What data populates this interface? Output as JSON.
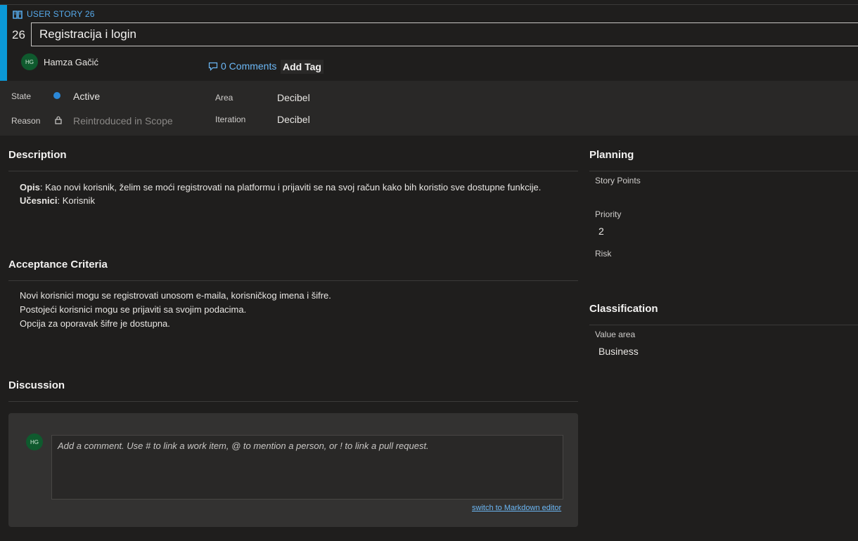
{
  "work_item": {
    "type_label": "USER STORY 26",
    "id": "26",
    "title": "Registracija i login",
    "assignee": {
      "initials": "HG",
      "name": "Hamza Gačić"
    },
    "comments_label": "0 Comments",
    "add_tag_label": "Add Tag"
  },
  "fields": {
    "state": {
      "label": "State",
      "value": "Active",
      "status_color": "#2b88d8"
    },
    "reason": {
      "label": "Reason",
      "value": "Reintroduced in Scope"
    },
    "area": {
      "label": "Area",
      "value": "Decibel"
    },
    "iteration": {
      "label": "Iteration",
      "value": "Decibel"
    }
  },
  "description": {
    "title": "Description",
    "opis_label": "Opis",
    "opis_text": ": Kao novi korisnik, želim se moći registrovati na platformu i prijaviti se na svoj račun kako bih koristio sve dostupne funkcije.",
    "ucesnici_label": "Učesnici",
    "ucesnici_text": ": Korisnik"
  },
  "acceptance": {
    "title": "Acceptance Criteria",
    "lines": [
      "Novi korisnici mogu se registrovati unosom e-maila, korisničkog imena i šifre.",
      "Postojeći korisnici mogu se prijaviti sa svojim podacima.",
      "Opcija za oporavak šifre je dostupna."
    ]
  },
  "discussion": {
    "title": "Discussion",
    "avatar_initials": "HG",
    "placeholder": "Add a comment. Use # to link a work item, @ to mention a person, or ! to link a pull request.",
    "markdown_link": "switch to Markdown editor"
  },
  "planning": {
    "title": "Planning",
    "story_points_label": "Story Points",
    "story_points_value": "",
    "priority_label": "Priority",
    "priority_value": "2",
    "risk_label": "Risk",
    "risk_value": ""
  },
  "classification": {
    "title": "Classification",
    "value_area_label": "Value area",
    "value_area_value": "Business"
  },
  "colors": {
    "accent": "#0b98d6",
    "link": "#6cb8f6",
    "avatar_bg": "#0f5a2e"
  }
}
